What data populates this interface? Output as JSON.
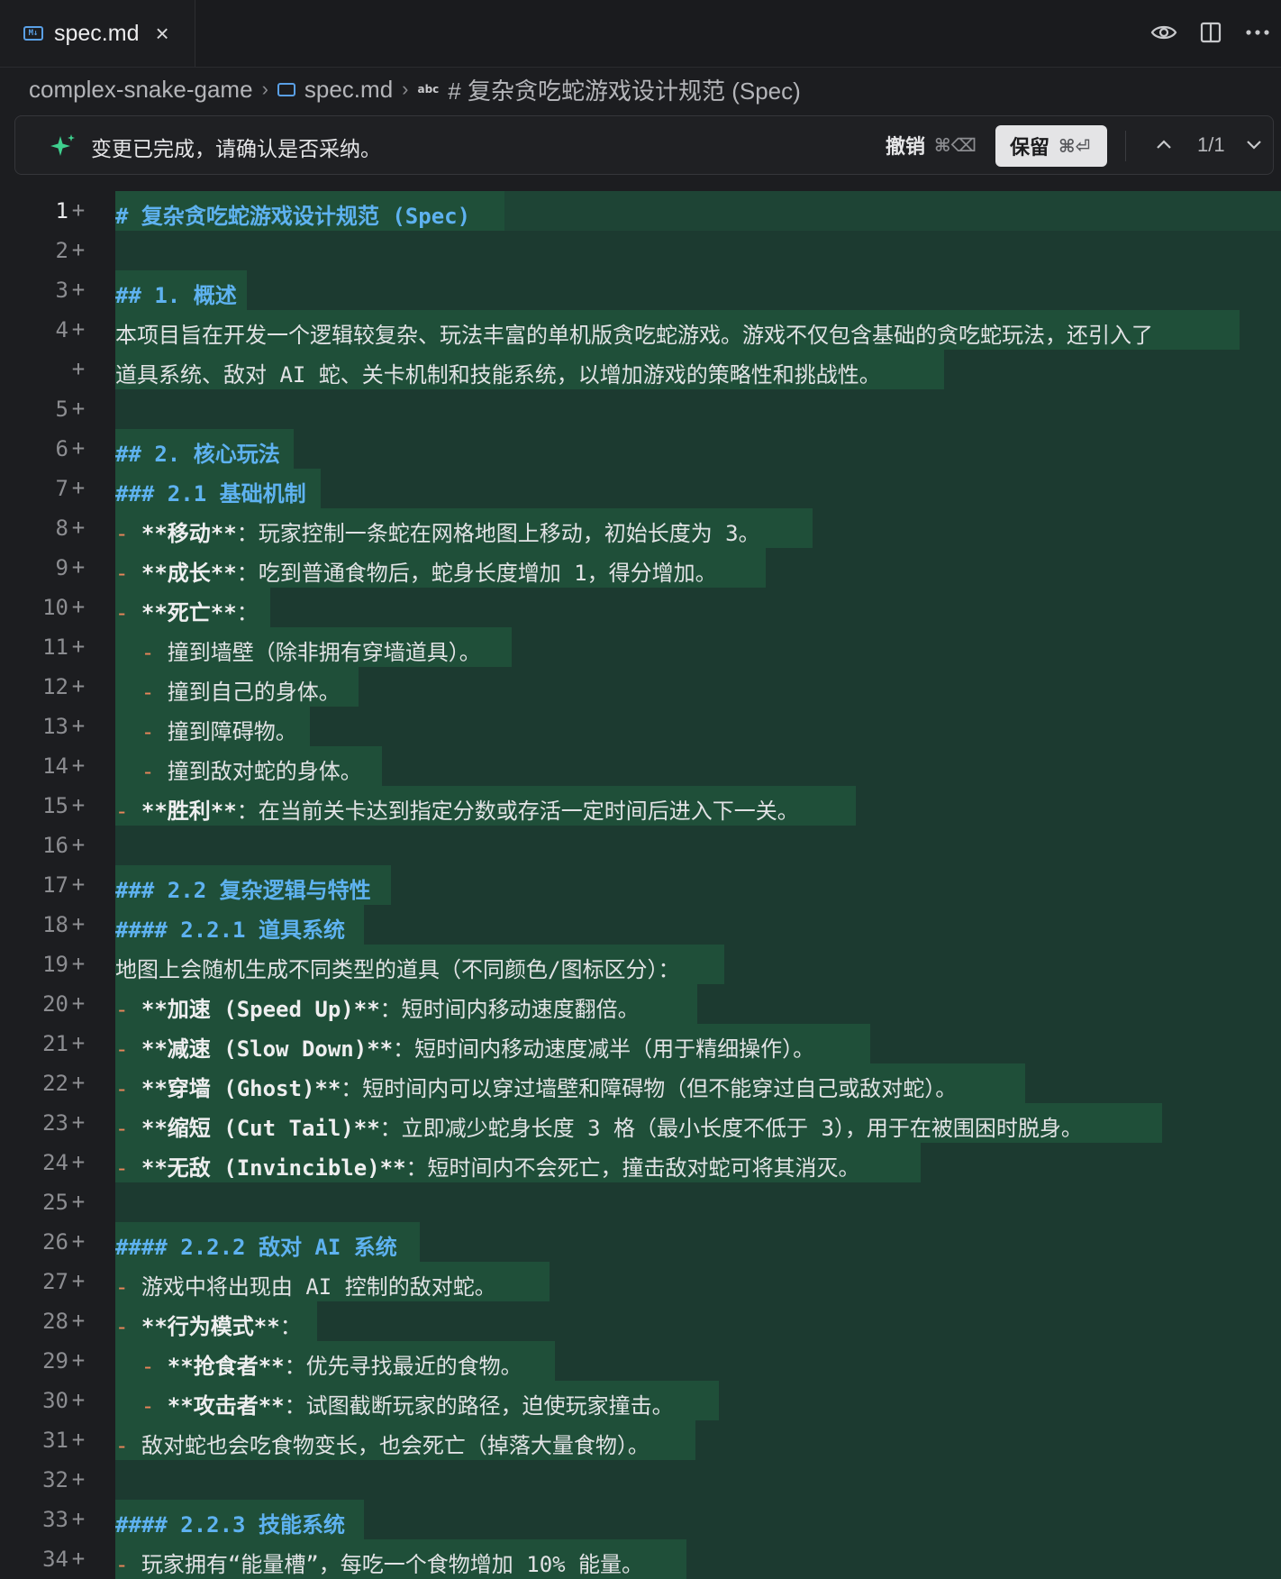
{
  "tab": {
    "name": "spec.md",
    "close": "×"
  },
  "tabbar_actions": [
    "eye-icon",
    "split-editor-icon",
    "more-icon"
  ],
  "breadcrumb": {
    "project": "complex-snake-game",
    "file": "spec.md",
    "symbol": "# 复杂贪吃蛇游戏设计规范 (Spec)",
    "symbol_icon_text": "abc"
  },
  "review": {
    "message": "变更已完成，请确认是否采纳。",
    "undo_label": "撤销",
    "undo_shortcut": "⌘⌫",
    "keep_label": "保留",
    "keep_shortcut": "⌘⏎",
    "counter": "1/1"
  },
  "colors": {
    "added_band": "#1c3a30",
    "added_text_bg": "#1f4f39",
    "heading": "#5eb2f0",
    "bullet": "#e8855a"
  },
  "lines": [
    {
      "n": "1",
      "segs": [
        [
          "h",
          "# 复杂贪吃蛇游戏设计规范 (Spec)"
        ]
      ],
      "w": 432
    },
    {
      "n": "2",
      "segs": [],
      "w": 0
    },
    {
      "n": "3",
      "segs": [
        [
          "h",
          "## 1. 概述"
        ]
      ],
      "w": 146
    },
    {
      "n": "4",
      "segs": [
        [
          "t",
          "本项目旨在开发一个逻辑较复杂、玩法丰富的单机版贪吃蛇游戏。游戏不仅包含基础的贪吃蛇玩法，还引入了"
        ]
      ],
      "w": 1248
    },
    {
      "n": "",
      "segs": [
        [
          "t",
          "道具系统、敌对 AI 蛇、关卡机制和技能系统，以增加游戏的策略性和挑战性。"
        ]
      ],
      "w": 920
    },
    {
      "n": "5",
      "segs": [],
      "w": 0
    },
    {
      "n": "6",
      "segs": [
        [
          "h",
          "## 2. 核心玩法"
        ]
      ],
      "w": 198
    },
    {
      "n": "7",
      "segs": [
        [
          "h",
          "### 2.1 基础机制"
        ]
      ],
      "w": 228
    },
    {
      "n": "8",
      "segs": [
        [
          "d",
          "- "
        ],
        [
          "b",
          "**移动**"
        ],
        [
          "t",
          "：玩家控制一条蛇在网格地图上移动，初始长度为 3。"
        ]
      ],
      "w": 774
    },
    {
      "n": "9",
      "segs": [
        [
          "d",
          "- "
        ],
        [
          "b",
          "**成长**"
        ],
        [
          "t",
          "：吃到普通食物后，蛇身长度增加 1，得分增加。"
        ]
      ],
      "w": 722
    },
    {
      "n": "10",
      "segs": [
        [
          "d",
          "- "
        ],
        [
          "b",
          "**死亡**"
        ],
        [
          "t",
          "："
        ]
      ],
      "w": 172
    },
    {
      "n": "11",
      "segs": [
        [
          "d",
          "  - "
        ],
        [
          "t",
          "撞到墙壁（除非拥有穿墙道具）。"
        ]
      ],
      "w": 440
    },
    {
      "n": "12",
      "segs": [
        [
          "d",
          "  - "
        ],
        [
          "t",
          "撞到自己的身体。"
        ]
      ],
      "w": 270
    },
    {
      "n": "13",
      "segs": [
        [
          "d",
          "  - "
        ],
        [
          "t",
          "撞到障碍物。"
        ]
      ],
      "w": 216
    },
    {
      "n": "14",
      "segs": [
        [
          "d",
          "  - "
        ],
        [
          "t",
          "撞到敌对蛇的身体。"
        ]
      ],
      "w": 296
    },
    {
      "n": "15",
      "segs": [
        [
          "d",
          "- "
        ],
        [
          "b",
          "**胜利**"
        ],
        [
          "t",
          "：在当前关卡达到指定分数或存活一定时间后进入下一关。"
        ]
      ],
      "w": 822
    },
    {
      "n": "16",
      "segs": [],
      "w": 0
    },
    {
      "n": "17",
      "segs": [
        [
          "h",
          "### 2.2 复杂逻辑与特性"
        ]
      ],
      "w": 306
    },
    {
      "n": "18",
      "segs": [
        [
          "h",
          "#### 2.2.1 道具系统"
        ]
      ],
      "w": 276
    },
    {
      "n": "19",
      "segs": [
        [
          "t",
          "地图上会随机生成不同类型的道具（不同颜色/图标区分）："
        ]
      ],
      "w": 676
    },
    {
      "n": "20",
      "segs": [
        [
          "d",
          "- "
        ],
        [
          "b",
          "**加速 (Speed Up)**"
        ],
        [
          "t",
          "：短时间内移动速度翻倍。"
        ]
      ],
      "w": 646
    },
    {
      "n": "21",
      "segs": [
        [
          "d",
          "- "
        ],
        [
          "b",
          "**减速 (Slow Down)**"
        ],
        [
          "t",
          "：短时间内移动速度减半（用于精细操作）。"
        ]
      ],
      "w": 838
    },
    {
      "n": "22",
      "segs": [
        [
          "d",
          "- "
        ],
        [
          "b",
          "**穿墙 (Ghost)**"
        ],
        [
          "t",
          "：短时间内可以穿过墙壁和障碍物（但不能穿过自己或敌对蛇）。"
        ]
      ],
      "w": 1010
    },
    {
      "n": "23",
      "segs": [
        [
          "d",
          "- "
        ],
        [
          "b",
          "**缩短 (Cut Tail)**"
        ],
        [
          "t",
          "：立即减少蛇身长度 3 格（最小长度不低于 3），用于在被围困时脱身。"
        ]
      ],
      "w": 1162
    },
    {
      "n": "24",
      "segs": [
        [
          "d",
          "- "
        ],
        [
          "b",
          "**无敌 (Invincible)**"
        ],
        [
          "t",
          "：短时间内不会死亡，撞击敌对蛇可将其消灭。"
        ]
      ],
      "w": 894
    },
    {
      "n": "25",
      "segs": [],
      "w": 0
    },
    {
      "n": "26",
      "segs": [
        [
          "h",
          "#### 2.2.2 敌对 AI 系统"
        ]
      ],
      "w": 338
    },
    {
      "n": "27",
      "segs": [
        [
          "d",
          "- "
        ],
        [
          "t",
          "游戏中将出现由 AI 控制的敌对蛇。"
        ]
      ],
      "w": 482
    },
    {
      "n": "28",
      "segs": [
        [
          "d",
          "- "
        ],
        [
          "b",
          "**行为模式**"
        ],
        [
          "t",
          "："
        ]
      ],
      "w": 224
    },
    {
      "n": "29",
      "segs": [
        [
          "d",
          "  - "
        ],
        [
          "b",
          "**抢食者**"
        ],
        [
          "t",
          "：优先寻找最近的食物。"
        ]
      ],
      "w": 488
    },
    {
      "n": "30",
      "segs": [
        [
          "d",
          "  - "
        ],
        [
          "b",
          "**攻击者**"
        ],
        [
          "t",
          "：试图截断玩家的路径，迫使玩家撞击。"
        ]
      ],
      "w": 670
    },
    {
      "n": "31",
      "segs": [
        [
          "d",
          "- "
        ],
        [
          "t",
          "敌对蛇也会吃食物变长，也会死亡（掉落大量食物）。"
        ]
      ],
      "w": 644
    },
    {
      "n": "32",
      "segs": [],
      "w": 0
    },
    {
      "n": "33",
      "segs": [
        [
          "h",
          "#### 2.2.3 技能系统"
        ]
      ],
      "w": 276
    },
    {
      "n": "34",
      "segs": [
        [
          "d",
          "- "
        ],
        [
          "t",
          "玩家拥有“能量槽”，每吃一个食物增加 10% 能量。"
        ]
      ],
      "w": 634
    }
  ]
}
